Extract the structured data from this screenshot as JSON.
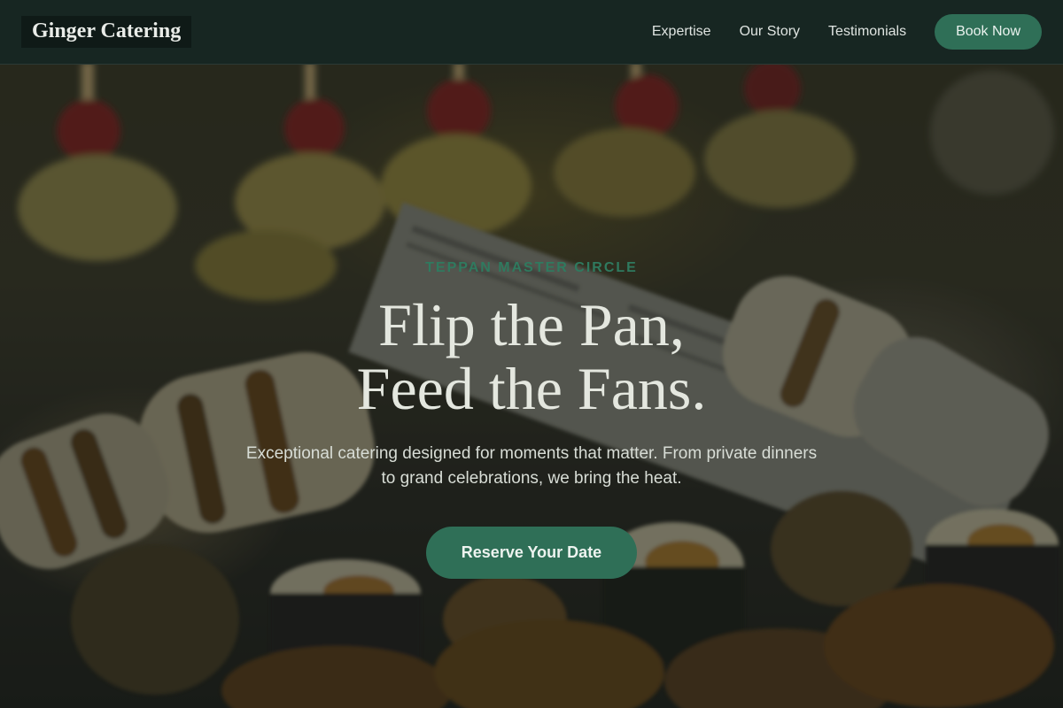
{
  "nav": {
    "brand": "Ginger Catering",
    "links": [
      "Expertise",
      "Our Story",
      "Testimonials"
    ],
    "cta": "Book Now"
  },
  "hero": {
    "eyebrow": "TEPPAN MASTER CIRCLE",
    "headline_line1": "Flip the Pan,",
    "headline_line2": "Feed the Fans.",
    "subhead": "Exceptional catering designed for moments that matter. From private dinners to grand celebrations, we bring the heat.",
    "cta": "Reserve Your Date"
  },
  "colors": {
    "nav_bg": "#172622",
    "accent_green": "#2f6f57",
    "eyebrow_green": "#2f7a5f",
    "headline": "#e4e7df"
  }
}
